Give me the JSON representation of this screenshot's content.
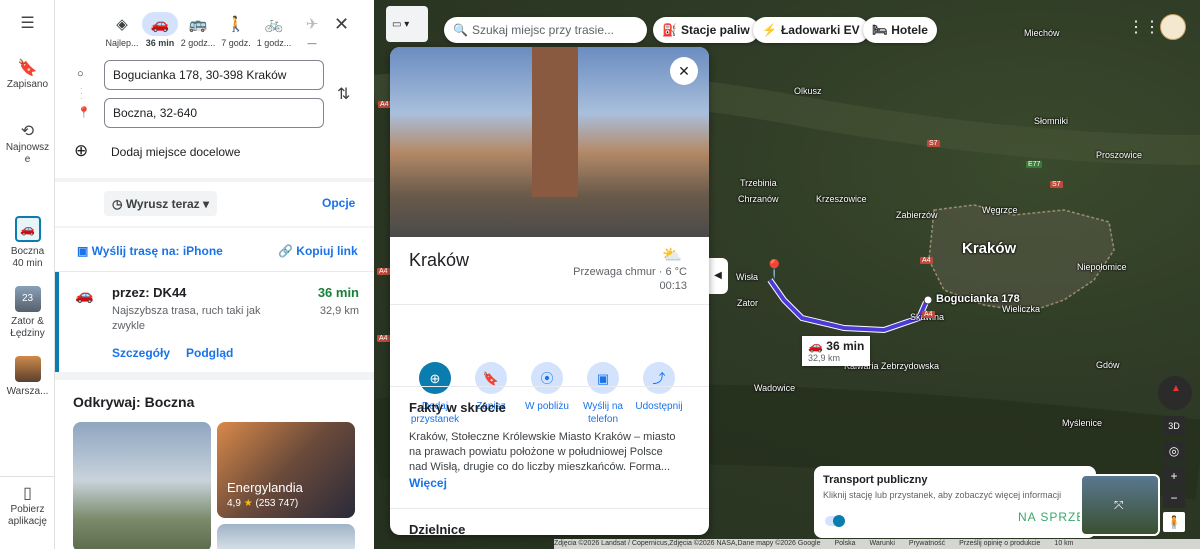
{
  "rail": {
    "menu_icon": "menu-icon",
    "saved": "Zapisano",
    "recent_line1": "Najnowsz",
    "recent_line2": "e",
    "trip_line1": "Boczna",
    "trip_line2": "40 min",
    "traffic_line1": "Zator &",
    "traffic_line2": "Łędziny",
    "traffic_badge": "23",
    "warsaw": "Warsza...",
    "get_app_line1": "Pobierz",
    "get_app_line2": "aplikację"
  },
  "modes": [
    {
      "label": "Najlep...",
      "icon": "directions-icon"
    },
    {
      "label": "36 min",
      "icon": "car-icon"
    },
    {
      "label": "2 godz...",
      "icon": "bus-icon"
    },
    {
      "label": "7 godz.",
      "icon": "walk-icon"
    },
    {
      "label": "1 godz...",
      "icon": "bike-icon"
    },
    {
      "label": "—",
      "icon": "plane-icon"
    }
  ],
  "route": {
    "origin": "Bogucianka 178, 30-398 Kraków",
    "destination": "Boczna, 32-640",
    "add_destination": "Dodaj miejsce docelowe",
    "depart": "Wyrusz teraz",
    "options": "Opcje",
    "send_route": "Wyślij trasę na: iPhone",
    "copy_link": "Kopiuj link"
  },
  "result": {
    "via": "przez: DK44",
    "desc_line1": "Najszybsza trasa, ruch taki jak",
    "desc_line2": "zwykle",
    "duration": "36 min",
    "distance": "32,9 km",
    "details": "Szczegóły",
    "preview": "Podgląd"
  },
  "discover": {
    "title": "Odkrywaj: Boczna",
    "card2_title": "Energylandia",
    "card2_rating": "4,9",
    "card2_reviews": "(253 747)"
  },
  "search": {
    "placeholder": "Szukaj miejsc przy trasie..."
  },
  "chips": {
    "fuel": "Stacje paliw",
    "ev": "Ładowarki EV",
    "hotels": "Hotele"
  },
  "place": {
    "name": "Kraków",
    "weather": "Przewaga chmur · 6 °C",
    "time": "00:13",
    "actions": [
      {
        "l1": "Dodaj",
        "l2": "przystanek",
        "icon": "add-stop-icon"
      },
      {
        "l1": "Zapisz",
        "l2": "",
        "icon": "bookmark-icon"
      },
      {
        "l1": "W pobliżu",
        "l2": "",
        "icon": "nearby-icon"
      },
      {
        "l1": "Wyślij na",
        "l2": "telefon",
        "icon": "send-to-phone-icon"
      },
      {
        "l1": "Udostępnij",
        "l2": "",
        "icon": "share-icon"
      }
    ],
    "facts_title": "Fakty w skrócie",
    "facts_l1": "Kraków, Stołeczne Królewskie Miasto Kraków – miasto",
    "facts_l2": "na prawach powiatu położone w południowej Polsce",
    "facts_l3": "nad Wisłą, drugie co do liczby mieszkańców. Forma...",
    "more": "Więcej",
    "districts": "Dzielnice"
  },
  "map": {
    "route_duration": "36 min",
    "route_distance": "32,9 km",
    "origin_label": "Bogucianka 178",
    "city": "Kraków",
    "towns": [
      "Miechów",
      "Olkusz",
      "Słomniki",
      "Trzebinia",
      "Krzeszowice",
      "Proszowice",
      "Chrzanów",
      "Zabierzów",
      "Węgrzce",
      "Niepołomice",
      "Zator",
      "Skawina",
      "Wieliczka",
      "Wadowice",
      "Kalwaria Zebrzydowska",
      "Gdów",
      "Myślenice",
      "Wisła"
    ],
    "roads": [
      "A4",
      "S7",
      "E77",
      "S7",
      "A4",
      "A4",
      "A4",
      "A4"
    ]
  },
  "transit": {
    "title": "Transport publiczny",
    "text": "Kliknij stację lub przystanek, aby zobaczyć więcej informacji"
  },
  "watermark": {
    "line1": "NA SPRZEDAŻ"
  },
  "controls": {
    "three_d": "3D"
  },
  "footer": [
    "Zdjęcia ©2026 Landsat / Copernicus,Zdjęcia ©2026 NASA,Dane mapy ©2026 Google",
    "Polska",
    "Warunki",
    "Prywatność",
    "Prześlij opinię o produkcie",
    "10 km"
  ]
}
